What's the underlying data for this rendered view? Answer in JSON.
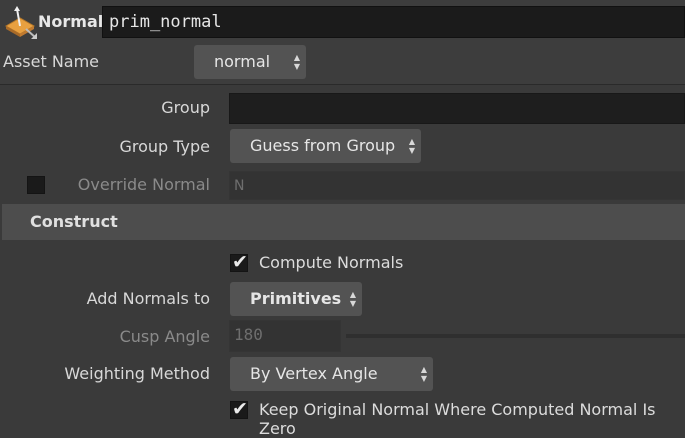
{
  "header": {
    "node_type": "Normal",
    "node_name": "prim_normal",
    "icon": "normal-node-icon"
  },
  "asset": {
    "label": "Asset Name",
    "value": "normal"
  },
  "params": {
    "group_label": "Group",
    "group_value": "",
    "group_type_label": "Group Type",
    "group_type_value": "Guess from Group",
    "override_normal_label": "Override Normal",
    "override_normal_value": "N",
    "override_normal_checked": false
  },
  "construct": {
    "title": "Construct",
    "compute_normals_label": "Compute Normals",
    "compute_normals_checked": true,
    "add_normals_label": "Add Normals to",
    "add_normals_value": "Primitives",
    "cusp_angle_label": "Cusp Angle",
    "cusp_angle_value": "180",
    "weighting_label": "Weighting Method",
    "weighting_value": "By Vertex Angle",
    "keep_original_label": "Keep Original Normal Where Computed Normal Is Zero",
    "keep_original_checked": true
  },
  "glyphs": {
    "check": "✔",
    "up": "▲",
    "down": "▼"
  },
  "colors": {
    "background": "#3a3a3a",
    "section": "#4d4d4d",
    "field": "#1e1e1e",
    "menu": "#535353",
    "icon_orange": "#e8a040"
  }
}
